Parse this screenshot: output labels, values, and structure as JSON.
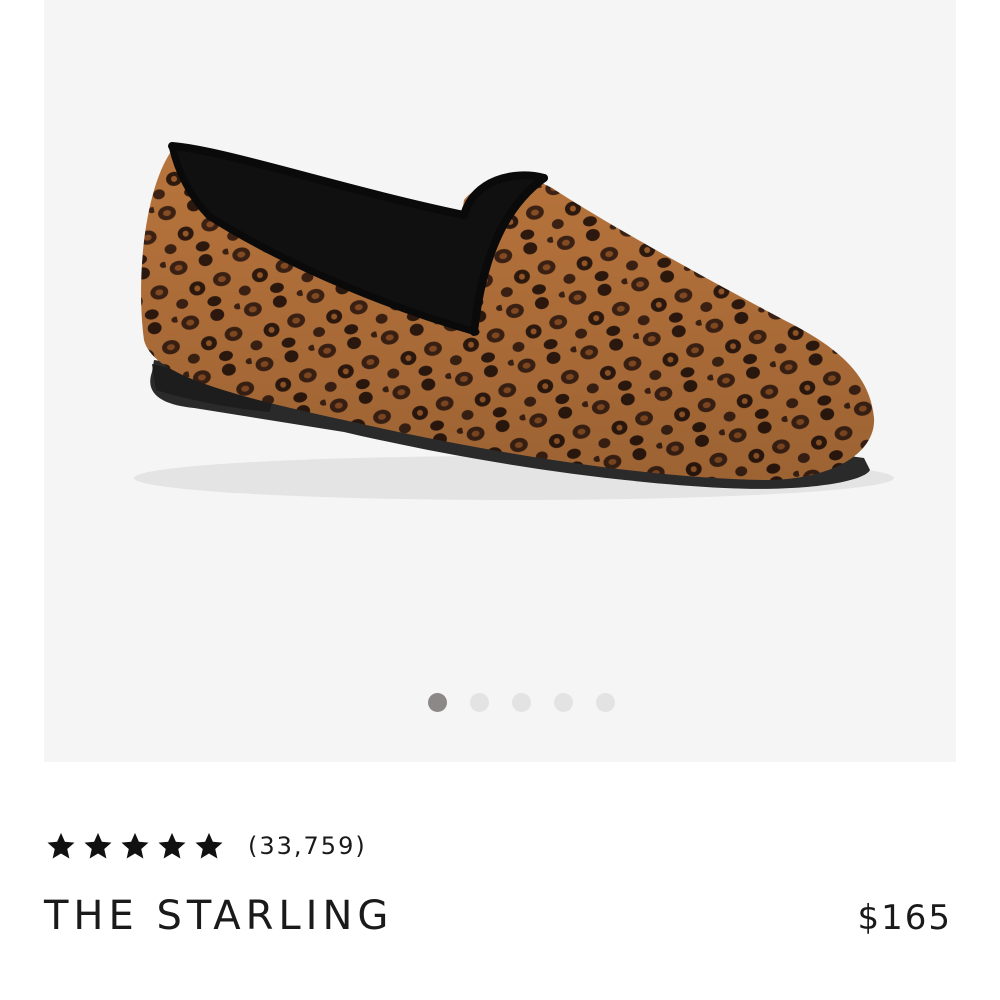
{
  "gallery": {
    "image_alt": "Leopard print loafer",
    "slide_count": 5,
    "active_index": 0
  },
  "rating": {
    "stars": 5,
    "review_count": "(33,759)"
  },
  "product": {
    "name": "THE STARLING",
    "price": "$165"
  },
  "colors": {
    "text": "#1a1a1a",
    "gallery_bg": "#f5f5f5",
    "dot_active": "#8c8888",
    "dot_inactive": "#e3e3e3"
  }
}
